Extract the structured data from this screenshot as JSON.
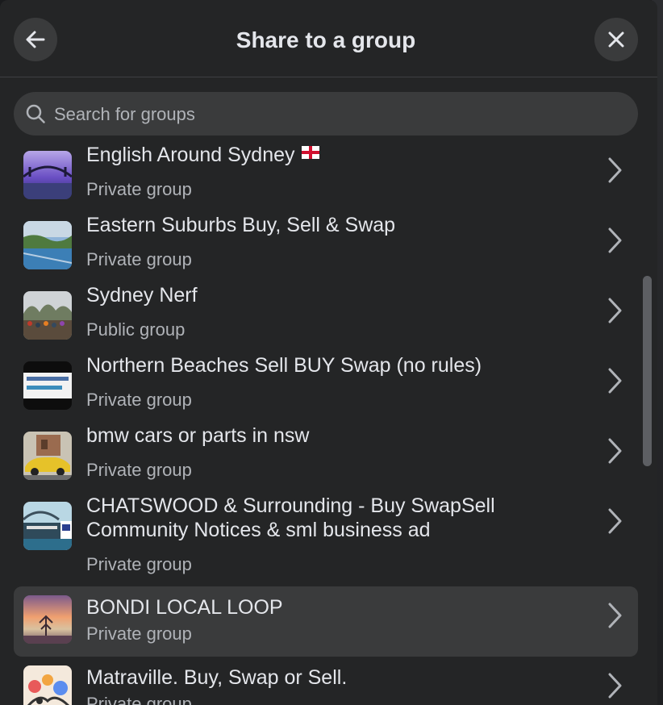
{
  "dialog": {
    "title": "Share to a group",
    "back_icon": "arrow-left-icon",
    "close_icon": "close-icon"
  },
  "search": {
    "placeholder": "Search for groups",
    "value": "",
    "icon": "search-icon"
  },
  "groups": [
    {
      "name": "English Around Sydney",
      "flag": "england-flag-icon",
      "type": "Private group"
    },
    {
      "name": "Eastern Suburbs Buy, Sell & Swap",
      "type": "Private group"
    },
    {
      "name": "Sydney Nerf",
      "type": "Public group"
    },
    {
      "name": "Northern Beaches Sell BUY Swap (no rules)",
      "type": "Private group"
    },
    {
      "name": "bmw cars or parts in nsw",
      "type": "Private group"
    },
    {
      "name": "CHATSWOOD & Surrounding - Buy SwapSell Community Notices & sml business ad",
      "type": "Private group"
    },
    {
      "name": "BONDI LOCAL LOOP",
      "type": "Private group",
      "highlighted": true
    },
    {
      "name": "Matraville. Buy, Swap or Sell.",
      "type": "Private group"
    }
  ],
  "colors": {
    "dialog_bg": "#242526",
    "control_bg": "#3a3b3c",
    "primary_text": "#e4e6eb",
    "secondary_text": "#b0b3b8"
  }
}
